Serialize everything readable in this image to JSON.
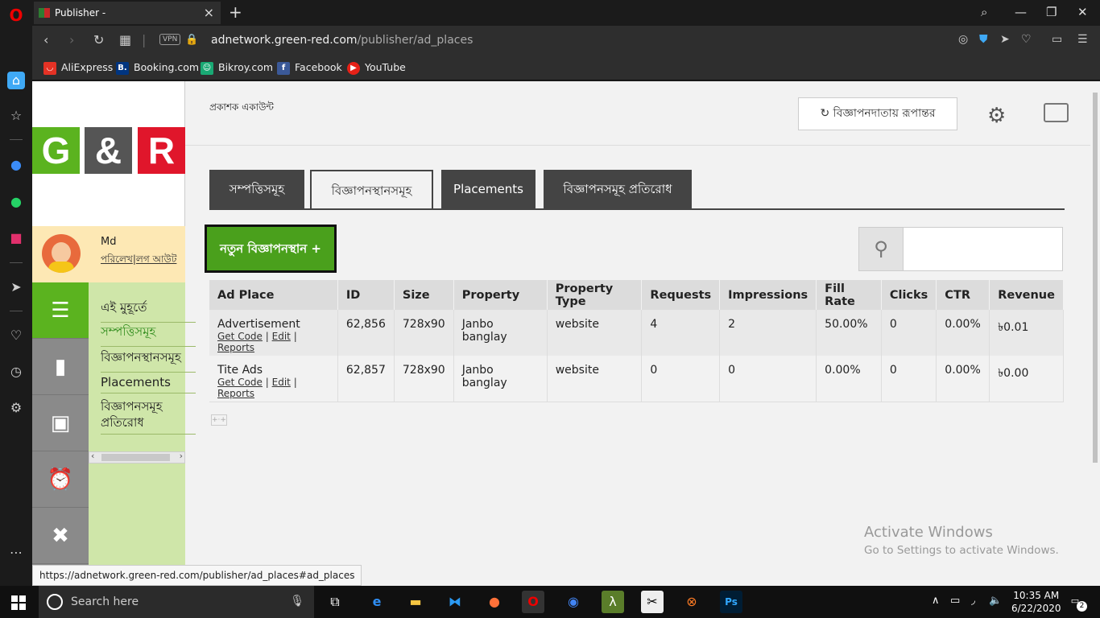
{
  "browser": {
    "tab_title": "Publisher -",
    "url_host": "adnetwork.green-red.com",
    "url_path": "/publisher/ad_places",
    "vpn_label": "VPN",
    "bookmarks": [
      "AliExpress",
      "Booking.com",
      "Bikroy.com",
      "Facebook",
      "YouTube"
    ],
    "status_url": "https://adnetwork.green-red.com/publisher/ad_places#ad_places"
  },
  "logo": {
    "g": "G",
    "amp": "&",
    "r": "R"
  },
  "user": {
    "name": "Md",
    "profile_link": "পরিলেখ",
    "separator": "|",
    "logout_link": "লগ আউট"
  },
  "menu": {
    "items": [
      "এই মুহূর্তে",
      "সম্পত্তিসমূহ",
      "বিজ্ঞাপনস্থানসমূহ",
      "Placements",
      "বিজ্ঞাপনসমূহ প্রতিরোধ"
    ]
  },
  "header": {
    "account_title": "প্রকাশক একাউন্ট",
    "convert_button": "বিজ্ঞাপনদাতায় রূপান্তর"
  },
  "tabs": [
    {
      "label": "সম্পত্তিসমূহ",
      "active": false
    },
    {
      "label": "বিজ্ঞাপনস্থানসমূহ",
      "active": true
    },
    {
      "label": "Placements",
      "active": false
    },
    {
      "label": "বিজ্ঞাপনসমূহ প্রতিরোধ",
      "active": false
    }
  ],
  "new_button": "নতুন বিজ্ঞাপনস্থান +",
  "table": {
    "columns": [
      "Ad Place",
      "ID",
      "Size",
      "Property",
      "Property Type",
      "Requests",
      "Impressions",
      "Fill Rate",
      "Clicks",
      "CTR",
      "Revenue"
    ],
    "rows": [
      {
        "ad_place": "Advertisement",
        "id": "62,856",
        "size": "728x90",
        "property": "Janbo banglay",
        "property_type": "website",
        "requests": "4",
        "impressions": "2",
        "fill_rate": "50.00%",
        "clicks": "0",
        "ctr": "0.00%",
        "revenue": "৳0.01"
      },
      {
        "ad_place": "Tite Ads",
        "id": "62,857",
        "size": "728x90",
        "property": "Janbo banglay",
        "property_type": "website",
        "requests": "0",
        "impressions": "0",
        "fill_rate": "0.00%",
        "clicks": "0",
        "ctr": "0.00%",
        "revenue": "৳0.00"
      }
    ],
    "actions": {
      "get_code": "Get Code",
      "edit": "Edit",
      "reports": "Reports",
      "sep": "|"
    }
  },
  "watermark": {
    "line1": "Activate Windows",
    "line2": "Go to Settings to activate Windows."
  },
  "taskbar": {
    "search_placeholder": "Search here",
    "time": "10:35 AM",
    "date": "6/22/2020",
    "notifications": "2"
  }
}
